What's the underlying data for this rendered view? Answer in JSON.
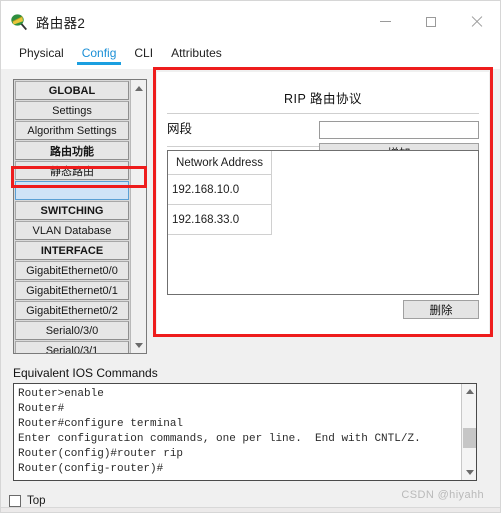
{
  "window": {
    "title": "路由器2",
    "icon": "router-device-icon",
    "controls": {
      "minimize": "minimize-icon",
      "maximize": "maximize-icon",
      "close": "close-icon"
    }
  },
  "tabs": [
    {
      "label": "Physical",
      "active": false
    },
    {
      "label": "Config",
      "active": true
    },
    {
      "label": "CLI",
      "active": false
    },
    {
      "label": "Attributes",
      "active": false
    }
  ],
  "sidebar": {
    "items": [
      {
        "label": "GLOBAL",
        "type": "header",
        "selected": false
      },
      {
        "label": "Settings",
        "type": "item",
        "selected": false
      },
      {
        "label": "Algorithm Settings",
        "type": "item",
        "selected": false
      },
      {
        "label": "路由功能",
        "type": "header",
        "selected": false
      },
      {
        "label": "静态路由",
        "type": "item",
        "selected": false
      },
      {
        "label": "",
        "type": "item",
        "selected": true
      },
      {
        "label": "SWITCHING",
        "type": "header",
        "selected": false
      },
      {
        "label": "VLAN Database",
        "type": "item",
        "selected": false
      },
      {
        "label": "INTERFACE",
        "type": "header",
        "selected": false
      },
      {
        "label": "GigabitEthernet0/0",
        "type": "item",
        "selected": false
      },
      {
        "label": "GigabitEthernet0/1",
        "type": "item",
        "selected": false
      },
      {
        "label": "GigabitEthernet0/2",
        "type": "item",
        "selected": false
      },
      {
        "label": "Serial0/3/0",
        "type": "item",
        "selected": false
      },
      {
        "label": "Serial0/3/1",
        "type": "item",
        "selected": false
      }
    ],
    "scrollbar": {
      "up": "caret-up-icon",
      "down": "caret-down-icon"
    }
  },
  "panel": {
    "title": "RIP 路由协议",
    "network_label": "网段",
    "network_input_value": "",
    "network_input_placeholder": "",
    "add_button": "增加",
    "delete_button": "删除",
    "table": {
      "columns": [
        "Network Address"
      ],
      "rows": [
        [
          "192.168.10.0"
        ],
        [
          "192.168.33.0"
        ]
      ]
    }
  },
  "ios": {
    "label": "Equivalent IOS Commands",
    "text": "Router>enable\nRouter#\nRouter#configure terminal\nEnter configuration commands, one per line.  End with CNTL/Z.\nRouter(config)#router rip\nRouter(config-router)#",
    "scrollbar": {
      "up": "caret-up-icon",
      "down": "caret-down-icon"
    }
  },
  "footer": {
    "top_checkbox_label": "Top",
    "top_checkbox_checked": false,
    "watermark": "CSDN @hiyahh"
  },
  "colors": {
    "accent": "#1b9fe0",
    "annotation": "#ee1c1c",
    "selection": "#cfe3f7"
  }
}
